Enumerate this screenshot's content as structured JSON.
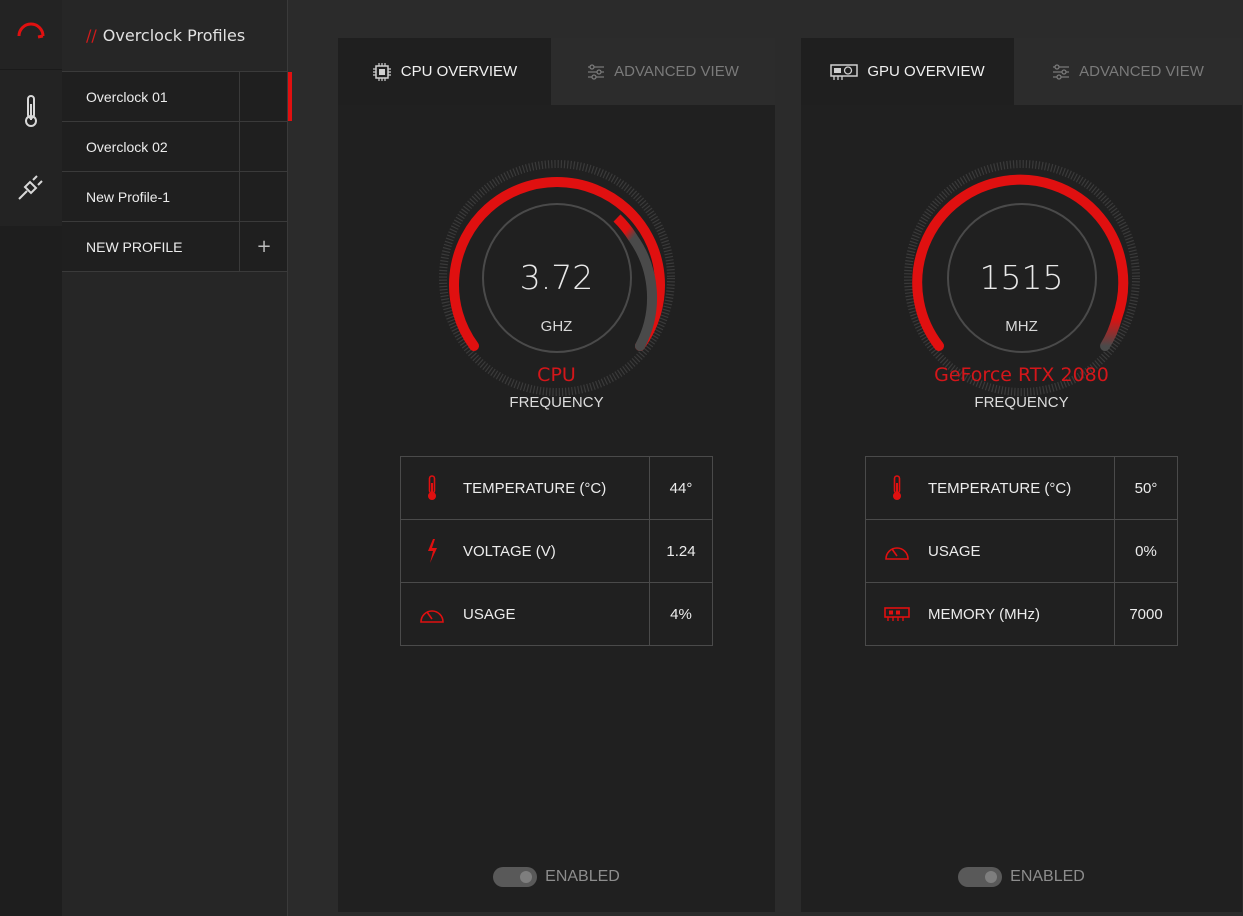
{
  "profiles": {
    "header_prefix": "//",
    "header_title": "Overclock Profiles",
    "items": [
      {
        "label": "Overclock 01",
        "active": true
      },
      {
        "label": "Overclock 02",
        "active": false
      },
      {
        "label": "New Profile-1",
        "active": false
      }
    ],
    "new_profile_label": "NEW PROFILE",
    "add_symbol": "+"
  },
  "rail": {
    "icons": [
      "speedometer-icon",
      "thermometer-icon",
      "plug-icon"
    ]
  },
  "cpu": {
    "tab_overview": "CPU OVERVIEW",
    "tab_advanced": "ADVANCED VIEW",
    "gauge_value": "3.72",
    "gauge_unit": "GHZ",
    "gauge_name": "CPU",
    "gauge_label": "FREQUENCY",
    "stats": [
      {
        "icon": "thermometer-icon",
        "label": "TEMPERATURE (°C)",
        "value": "44°"
      },
      {
        "icon": "lightning-icon",
        "label": "VOLTAGE (V)",
        "value": "1.24"
      },
      {
        "icon": "gauge-icon",
        "label": "USAGE",
        "value": "4%"
      }
    ],
    "toggle_label": "ENABLED"
  },
  "gpu": {
    "tab_overview": "GPU OVERVIEW",
    "tab_advanced": "ADVANCED VIEW",
    "gauge_value": "1515",
    "gauge_unit": "MHZ",
    "gauge_name": "GeForce RTX 2080",
    "gauge_label": "FREQUENCY",
    "stats": [
      {
        "icon": "thermometer-icon",
        "label": "TEMPERATURE (°C)",
        "value": "50°"
      },
      {
        "icon": "gauge-icon",
        "label": "USAGE",
        "value": "0%"
      },
      {
        "icon": "memory-icon",
        "label": "MEMORY (MHz)",
        "value": "7000"
      }
    ],
    "toggle_label": "ENABLED"
  },
  "colors": {
    "accent": "#e01010",
    "background": "#2b2b2b",
    "panel": "#202020"
  }
}
